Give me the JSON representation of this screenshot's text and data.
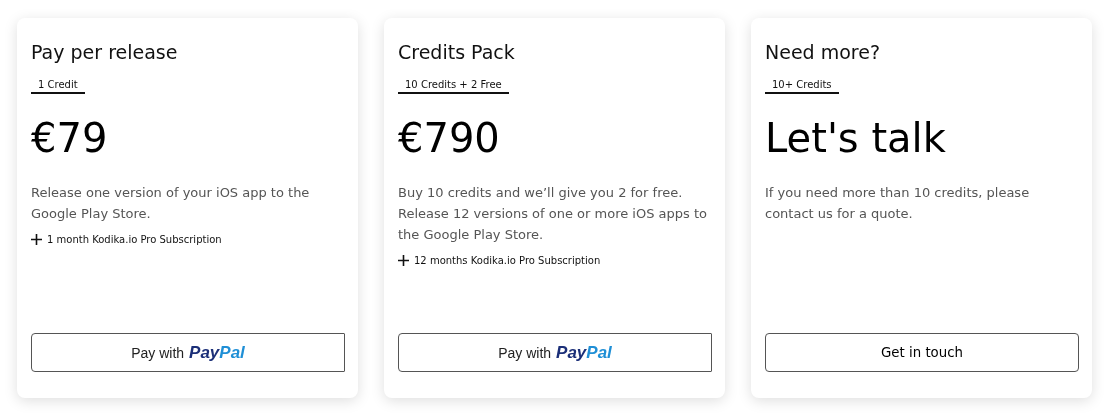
{
  "plans": [
    {
      "title": "Pay per release",
      "badge": "1 Credit",
      "price": "€79",
      "description": "Release one version of your iOS app to the Google Play Store.",
      "features": [
        "1 month Kodika.io Pro Subscription"
      ],
      "button": {
        "kind": "paypal",
        "label": "Pay with",
        "brand_parts": [
          "Pay",
          "Pal"
        ]
      }
    },
    {
      "title": "Credits Pack",
      "badge": "10 Credits + 2 Free",
      "price": "€790",
      "description": "Buy 10 credits and we’ll give you 2 for free. Release 12 versions of one or more iOS apps to the Google Play Store.",
      "features": [
        "12 months Kodika.io Pro Subscription"
      ],
      "button": {
        "kind": "paypal",
        "label": "Pay with",
        "brand_parts": [
          "Pay",
          "Pal"
        ]
      }
    },
    {
      "title": "Need more?",
      "badge": "10+ Credits",
      "price": "Let's talk",
      "description": "If you need more than 10 credits, please contact us for a quote.",
      "button": {
        "kind": "plain",
        "label": "Get in touch"
      }
    }
  ]
}
